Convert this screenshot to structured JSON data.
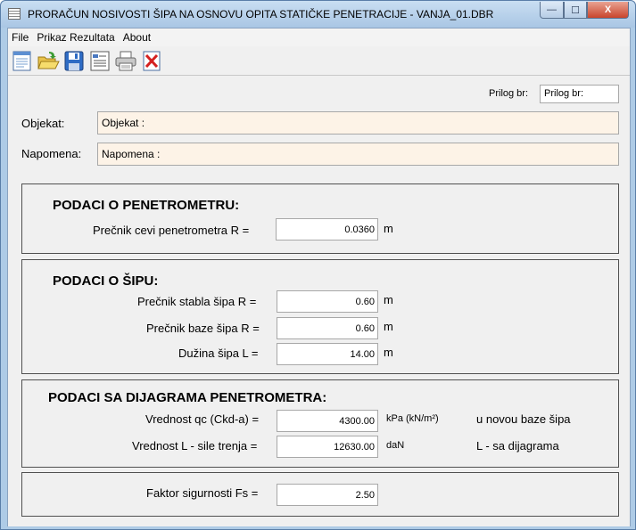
{
  "window": {
    "title": "PRORAČUN NOSIVOSTI ŠIPA NA OSNOVU OPITA STATIČKE PENETRACIJE - VANJA_01.DBR",
    "minimize_glyph": "—",
    "maximize_glyph": "☐",
    "close_glyph": "X"
  },
  "menu": {
    "file": "File",
    "results": "Prikaz Rezultata",
    "about": "About"
  },
  "toolbar_icons": [
    "new-document-icon",
    "open-folder-icon",
    "save-disk-icon",
    "report-icon",
    "printer-icon",
    "exit-icon"
  ],
  "header": {
    "prilog_label": "Prilog br:",
    "prilog_value": "Prilog br:",
    "objekat_label": "Objekat:",
    "objekat_value": "Objekat  :",
    "napomena_label": "Napomena:",
    "napomena_value": "Napomena :"
  },
  "penetrometar": {
    "title": "PODACI O PENETROMETRU:",
    "precnik_label": "Prečnik cevi penetrometra R =",
    "precnik_value": "0.0360",
    "precnik_unit": "m"
  },
  "sip": {
    "title": "PODACI O ŠIPU:",
    "stablo_label": "Prečnik stabla šipa R =",
    "stablo_value": "0.60",
    "stablo_unit": "m",
    "baza_label": "Prečnik baze šipa R =",
    "baza_value": "0.60",
    "baza_unit": "m",
    "duzina_label": "Dužina šipa  L =",
    "duzina_value": "14.00",
    "duzina_unit": "m"
  },
  "dijagram": {
    "title": "PODACI SA DIJAGRAMA  PENETROMETRA:",
    "qc_label": "Vrednost qc (Ckd-a) =",
    "qc_value": "4300.00",
    "qc_unit": "kPa (kN/m²)",
    "qc_note": "u novou baze šipa",
    "L_label": "Vrednost L - sile trenja =",
    "L_value": "12630.00",
    "L_unit": "daN",
    "L_note": "L - sa dijagrama"
  },
  "sigurnost": {
    "fs_label": "Faktor sigurnosti Fs =",
    "fs_value": "2.50"
  }
}
